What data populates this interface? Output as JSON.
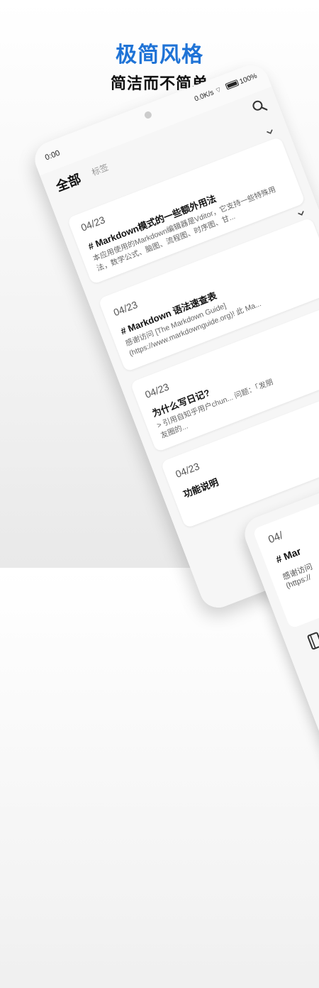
{
  "headline": {
    "title": "极简风格",
    "subtitle": "简洁而不简单"
  },
  "status_bar": {
    "time": "0:00",
    "network_speed": "0.0K/s",
    "battery": "100%"
  },
  "tabs": {
    "all": "全部",
    "tags": "标签"
  },
  "notes": [
    {
      "date": "04/23",
      "title": "# Markdown模式的一些额外用法",
      "body": "本应用使用的Markdown编辑器是Vditor，它支持一些特殊用法，数学公式、脑图、流程图、时序图、甘..."
    },
    {
      "date": "04/23",
      "title": "# Markdown 语法速查表",
      "body": "感谢访问 [The Markdown Guide](https://www.markdownguide.org)! 此 Ma..."
    },
    {
      "date": "04/23",
      "title": "为什么写日记?",
      "body": "> 引用自知乎用户chun... 问题：「发朋友圈的..."
    },
    {
      "date": "04/23",
      "title": "功能说明",
      "body": ""
    }
  ],
  "second_phone": {
    "date": "04/",
    "title": "# Mar",
    "body_line1": "感谢访问",
    "body_line2": "(https://"
  },
  "colors": {
    "accent": "#1f73d6"
  },
  "icons": [
    "search-icon",
    "chevron-down-icon",
    "notebook-icon",
    "clock-icon"
  ]
}
